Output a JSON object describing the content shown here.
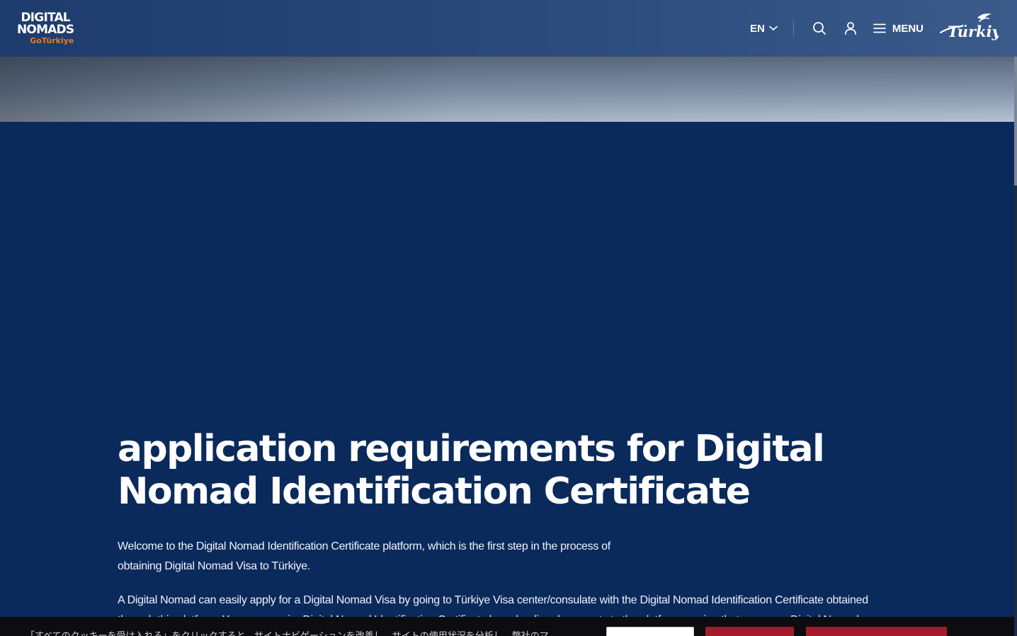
{
  "header": {
    "logo": {
      "line1": "DIGITAL",
      "line2": "NOMADS",
      "line3": "GoTürkiye"
    },
    "language": "EN",
    "icons": {
      "lang_toggle": "chevron-down-icon",
      "search": "search-icon",
      "account": "user-icon",
      "menu": "hamburger-icon"
    },
    "menu_label": "MENU",
    "brand": "Türkiye"
  },
  "main": {
    "title": "application requirements for Digital Nomad Identification Certificate",
    "intro": "Welcome to the Digital Nomad Identification Certificate platform, which is the first step in the process of obtaining Digital Nomad Visa to Türkiye.",
    "body": "A Digital Nomad can easily apply for a Digital Nomad Visa by going to Türkiye Visa center/consulate with the Digital Nomad Identification Certificate obtained through this platform. You can acquire Digital Nomad Identification Certificate by uploading documents to the platform proving that you are a Digital Nomad."
  },
  "cookie_banner": {
    "text": "「すべてのクッキーを受け入れる」をクリックすると、サイトナビゲーションを改善し、サイトの使用状況を分析し、弊社のマ"
  },
  "colors": {
    "page_background": "#0b2a5c",
    "accent_orange": "#e07b29",
    "cookie_button": "#a51b2e"
  }
}
